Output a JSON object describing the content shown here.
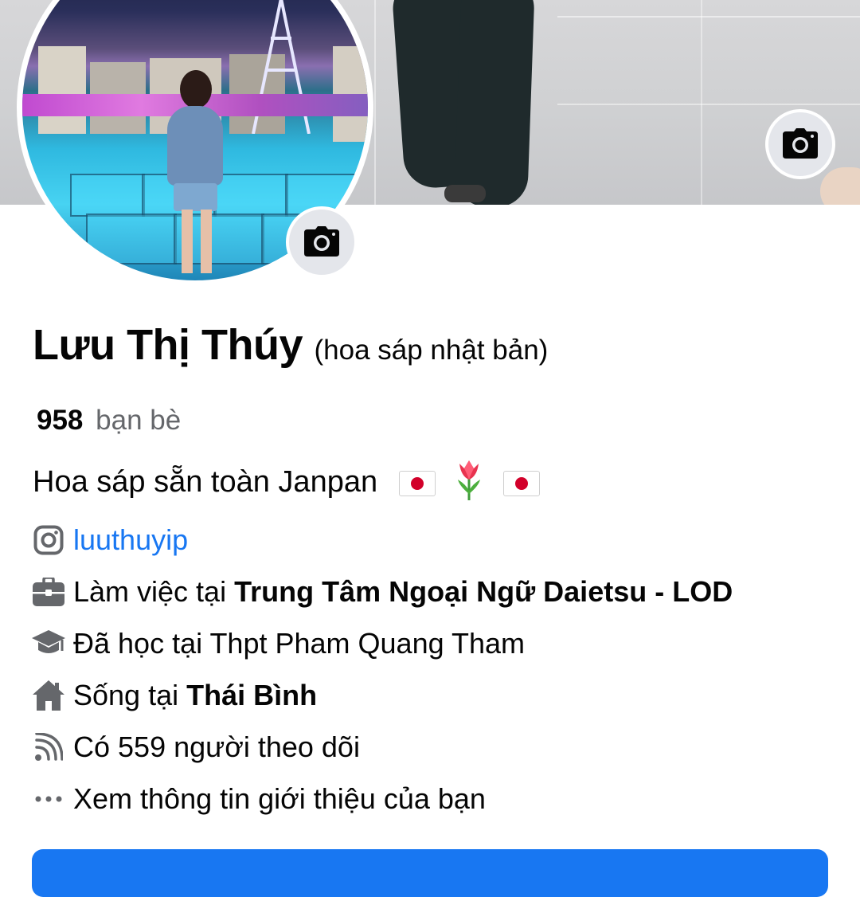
{
  "profile": {
    "name": "Lưu Thị Thúy",
    "alternate_name": "(hoa sáp nhật bản)",
    "friends_count": "958",
    "friends_label": "bạn bè",
    "bio": "Hoa sáp sẵn toàn Janpan"
  },
  "details": {
    "instagram": "luuthuyip",
    "work_prefix": "Làm việc tại",
    "work_place": "Trung Tâm Ngoại Ngữ Daietsu - LOD",
    "education": "Đã học tại Thpt Pham Quang Tham",
    "lives_prefix": "Sống tại",
    "lives_place": "Thái Bình",
    "followers": "Có 559 người theo dõi",
    "see_about": "Xem thông tin giới thiệu của bạn"
  },
  "icons": {
    "cover_camera": "camera-icon",
    "avatar_camera": "camera-icon",
    "instagram": "instagram-icon",
    "work": "briefcase-icon",
    "education": "graduation-cap-icon",
    "home": "home-icon",
    "followers": "rss-icon",
    "more": "more-dots-icon",
    "bio_emojis": [
      "japan-flag-icon",
      "tulip-icon",
      "japan-flag-icon"
    ]
  },
  "colors": {
    "link": "#1877f2",
    "primary_button": "#1877f2",
    "secondary_text": "#65676b",
    "icon_button_bg": "#e4e6eb"
  }
}
